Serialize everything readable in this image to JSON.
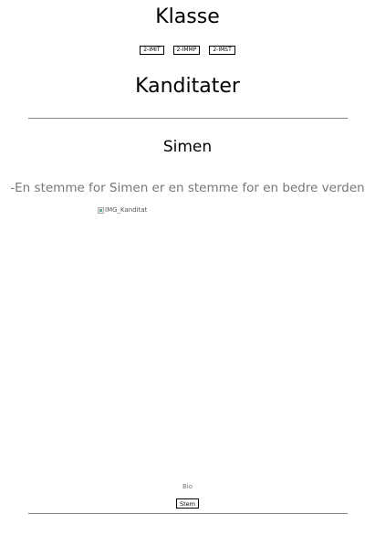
{
  "klasse": {
    "title": "Klasse",
    "classes": [
      "2-IMIT",
      "2-IMMP",
      "2-IMST"
    ]
  },
  "kandidater": {
    "title": "Kanditater"
  },
  "candidate": {
    "name": "Simen",
    "slogan": "-En stemme for Simen er en stemme for en bedre verden",
    "image_alt": "IMG_Kanditat",
    "bio_label": "Bio",
    "vote_label": "Stem"
  }
}
